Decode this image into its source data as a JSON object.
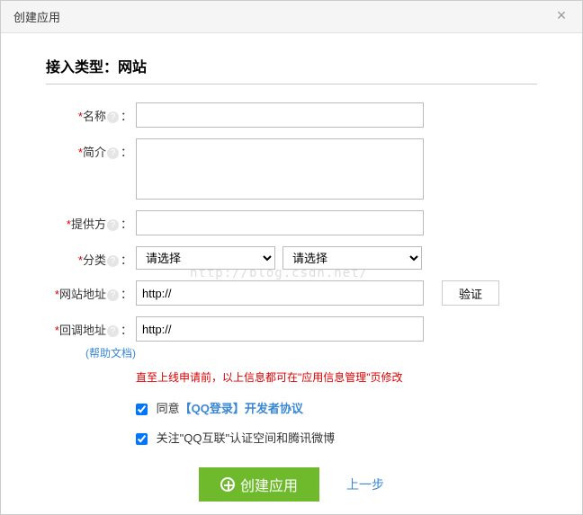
{
  "dialog": {
    "title": "创建应用"
  },
  "section": {
    "heading": "接入类型：网站"
  },
  "fields": {
    "name": {
      "label": "名称",
      "value": ""
    },
    "intro": {
      "label": "简介",
      "value": ""
    },
    "provider": {
      "label": "提供方",
      "value": ""
    },
    "category": {
      "label": "分类",
      "placeholder1": "请选择",
      "placeholder2": "请选择"
    },
    "site_url": {
      "label": "网站地址",
      "value": "http://"
    },
    "callback": {
      "label": "回调地址",
      "value": "http://",
      "help_doc": "(帮助文档)"
    }
  },
  "verify": {
    "label": "验证"
  },
  "hint": {
    "text": "直至上线申请前，以上信息都可在\"应用信息管理\"页修改"
  },
  "agree": {
    "prefix": "同意",
    "link": "【QQ登录】开发者协议"
  },
  "follow": {
    "text": "关注\"QQ互联\"认证空间和腾讯微博"
  },
  "actions": {
    "create": "创建应用",
    "prev": "上一步"
  },
  "watermark": "http://blog.csdn.net/"
}
